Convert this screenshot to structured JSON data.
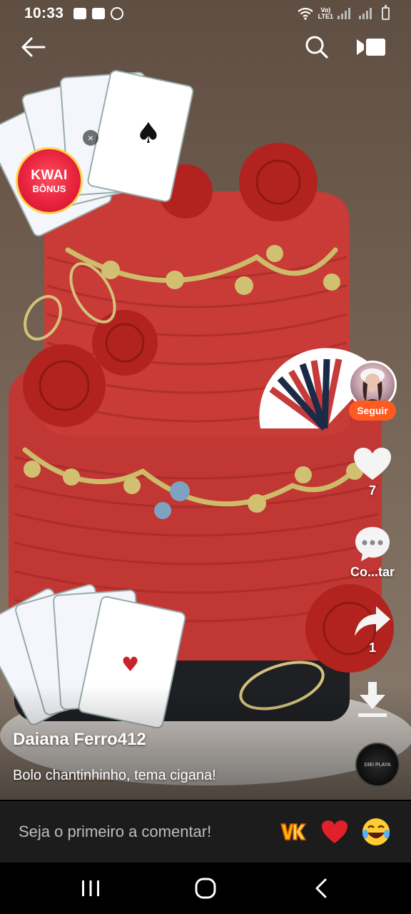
{
  "status_bar": {
    "time": "10:33",
    "network_top": "Vo)",
    "network_bottom": "LTE1"
  },
  "top_bar": {
    "back_icon": "arrow-left-icon",
    "search_icon": "search-icon",
    "mode_icon": "video-mode-icon"
  },
  "kwai_bonus": {
    "title": "KWAI",
    "subtitle": "BÔNUS",
    "close": "×"
  },
  "author": {
    "name": "Daiana Ferro412",
    "follow_label": "Seguir"
  },
  "actions": {
    "like_count": "7",
    "comment_label": "Co...tar",
    "share_count": "1"
  },
  "caption": "Bolo chantinhinho, tema cigana!",
  "music": {
    "disc_text": "DIEI PLAYA"
  },
  "comment_bar": {
    "placeholder": "Seja o primeiro a comentar!"
  },
  "colors": {
    "accent": "#ff5a1f",
    "cake_red": "#c63a36",
    "gold": "#c9b363",
    "comment_bg": "#1c1c1c"
  }
}
